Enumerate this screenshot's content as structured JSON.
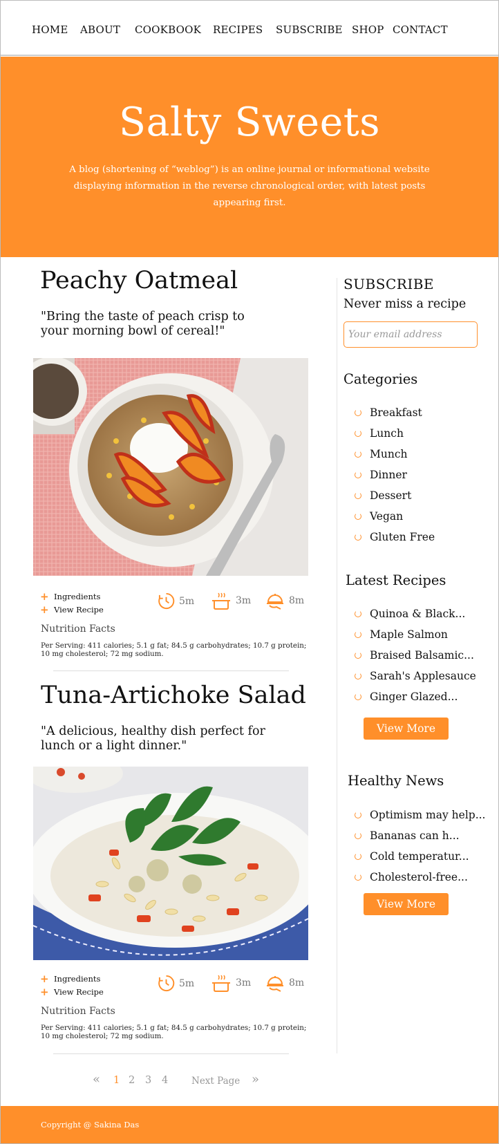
{
  "nav": [
    "HOME",
    "ABOUT",
    "COOKBOOK",
    "RECIPES",
    "SUBSCRIBE",
    "SHOP",
    "CONTACT"
  ],
  "hero": {
    "title": "Salty Sweets",
    "description": "A blog (shortening of “weblog”) is an online journal or informational website displaying information in the reverse chronological order, with latest posts appearing first."
  },
  "posts": [
    {
      "title": "Peachy Oatmeal",
      "quote": "\"Bring the taste of peach crisp to your morning bowl of cereal!\"",
      "ingredients_label": "Ingredients",
      "view_recipe_label": "View Recipe",
      "prep_time": "5m",
      "cook_time": "3m",
      "serve_time": "8m",
      "nutrition_title": "Nutrition Facts",
      "nutrition_text": "Per Serving: 411 calories; 5.1 g fat; 84.5 g carbohydrates; 10.7 g protein; 10 mg cholesterol; 72 mg sodium."
    },
    {
      "title": "Tuna-Artichoke Salad",
      "quote": "\"A delicious, healthy dish perfect for lunch or a light dinner.\"",
      "ingredients_label": "Ingredients",
      "view_recipe_label": "View Recipe",
      "prep_time": "5m",
      "cook_time": "3m",
      "serve_time": "8m",
      "nutrition_title": "Nutrition Facts",
      "nutrition_text": "Per Serving: 411 calories; 5.1 g fat; 84.5 g carbohydrates; 10.7 g protein; 10 mg cholesterol; 72 mg sodium."
    }
  ],
  "sidebar": {
    "subscribe_title": "SUBSCRIBE",
    "subscribe_subtitle": "Never miss a recipe",
    "email_placeholder": "Your email address",
    "categories_title": "Categories",
    "categories": [
      "Breakfast",
      "Lunch",
      "Munch",
      "Dinner",
      "Dessert",
      "Vegan",
      "Gluten Free"
    ],
    "latest_title": "Latest Recipes",
    "latest": [
      "Quinoa & Black...",
      "Maple Salmon",
      "Braised Balsamic...",
      "Sarah's Applesauce",
      "Ginger Glazed..."
    ],
    "latest_button": "View More",
    "news_title": "Healthy News",
    "news": [
      "Optimism may help...",
      "Bananas can h...",
      "Cold temperatur...",
      "Cholesterol-free..."
    ],
    "news_button": "View More"
  },
  "pagination": {
    "prev_icon": "«",
    "pages": [
      "1",
      "2",
      "3",
      "4"
    ],
    "current": "1",
    "next_label": "Next Page",
    "next_icon": "»"
  },
  "footer": {
    "copyright": "Copyright @ Sakina Das"
  },
  "colors": {
    "accent": "#ff8f2a"
  }
}
